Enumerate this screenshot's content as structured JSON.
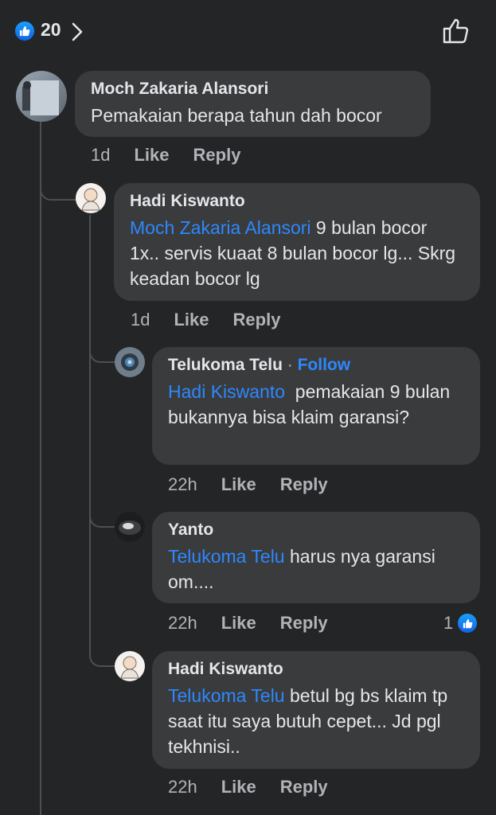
{
  "header": {
    "reaction_count": "20"
  },
  "comments": [
    {
      "author": "Moch Zakaria Alansori",
      "text": "Pemakaian berapa tahun dah bocor",
      "time": "1d",
      "like": "Like",
      "reply": "Reply"
    },
    {
      "author": "Hadi Kiswanto",
      "mention": "Moch Zakaria Alansori",
      "text_line1": " 9 bulan bocor",
      "text_rest": "1x.. servis kuaat 8 bulan bocor lg... Skrg keadan bocor lg",
      "time": "1d",
      "like": "Like",
      "reply": "Reply"
    },
    {
      "author": "Telukoma Telu",
      "separator": "·",
      "follow": "Follow",
      "mention": "Hadi Kiswanto",
      "text": "  pemakaian 9 bulan bukannya bisa klaim garansi?",
      "time": "22h",
      "like": "Like",
      "reply": "Reply"
    },
    {
      "author": "Yanto",
      "mention": "Telukoma Telu",
      "text": " harus nya garansi om....",
      "time": "22h",
      "like": "Like",
      "reply": "Reply",
      "reaction_count": "1"
    },
    {
      "author": "Hadi Kiswanto",
      "mention": "Telukoma Telu",
      "text": " betul bg bs klaim tp saat itu saya butuh cepet... Jd pgl tekhnisi..",
      "time": "22h",
      "like": "Like",
      "reply": "Reply"
    }
  ],
  "colors": {
    "background": "#242526",
    "bubble": "#3a3b3c",
    "accent": "#2d88ff",
    "secondary_text": "#b0b3b8"
  }
}
